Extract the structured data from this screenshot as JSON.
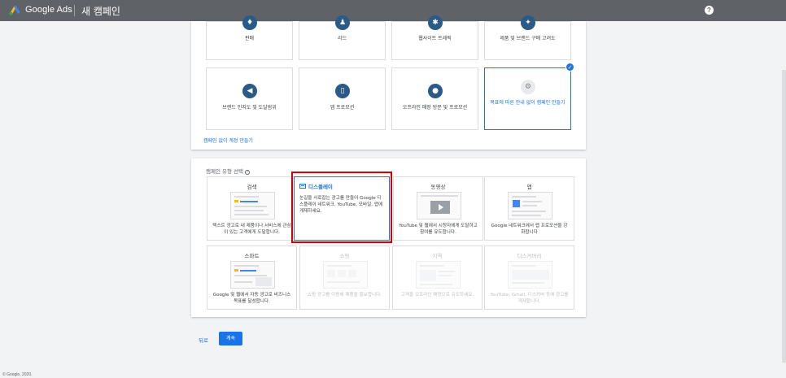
{
  "topbar": {
    "brand": "Google Ads",
    "page_title": "새 캠페인",
    "help_icon": "?"
  },
  "goals": {
    "row1": [
      "판매",
      "리드",
      "웹사이트 트래픽",
      "제품 및 브랜드 구매 고려도"
    ],
    "row2": [
      {
        "label": "브랜드 인지도 및 도달범위",
        "icon": "megaphone-icon",
        "glyph": "◀"
      },
      {
        "label": "앱 프로모션",
        "icon": "phone-icon",
        "glyph": "▯"
      },
      {
        "label": "오프라인 매장 방문 및 프로모션",
        "icon": "pin-icon",
        "glyph": "●"
      },
      {
        "label": "목표에 따른 안내 없이 캠페인 만들기",
        "icon": "gear-icon",
        "glyph": "⚙"
      }
    ],
    "selected_check": "✓",
    "no_guidance_link": "캠페인 없이 계정 만들기"
  },
  "campaign_types": {
    "section_title": "캠페인 유형 선택",
    "help_glyph": "?",
    "display": {
      "title": "디스플레이",
      "desc": "눈길을 사로잡는 광고를 만들어 Google 디스플레이 네트워크, YouTube, 모바일, 앱에 게재하세요."
    },
    "cards": [
      {
        "title": "검색",
        "desc": "텍스트 광고로 내 제품이나 서비스에 관심이 있는 고객에게 도달합니다."
      },
      {
        "title": "동영상",
        "desc": "YouTube 및 웹에서 시청자에게 도달하고 참여를 유도합니다."
      },
      {
        "title": "앱",
        "desc": "Google 네트워크에서 앱 프로모션을 강화합니다"
      },
      {
        "title": "스마트",
        "desc": "Google 및 웹에서 자동 광고로 비즈니스 목표를 달성합니다."
      },
      {
        "title": "쇼핑",
        "desc": "쇼핑 광고를 이용해 제품을 홍보합니다."
      },
      {
        "title": "지역",
        "desc": "고객을 오프라인 매장으로 유도하세요."
      },
      {
        "title": "디스커버리",
        "desc": "YouTube, Gmail, 디스커버 등에 광고를 게재합니다."
      }
    ]
  },
  "actions": {
    "back": "뒤로",
    "continue": "계속"
  },
  "footer": "© Google, 2020."
}
